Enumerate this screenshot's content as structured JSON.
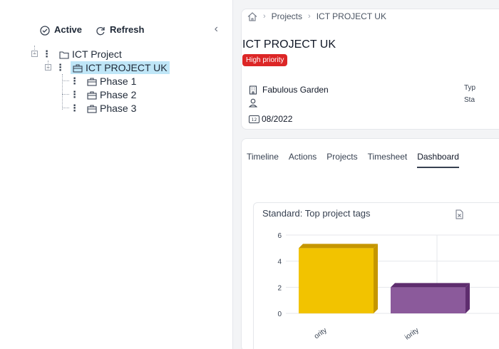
{
  "left_panel": {
    "active_label": "Active",
    "refresh_label": "Refresh",
    "tree": [
      {
        "label": "ICT Project",
        "icon": "folder-icon",
        "level": 0
      },
      {
        "label": "ICT PROJECT UK",
        "icon": "briefcase-icon",
        "level": 1,
        "selected": true
      },
      {
        "label": "Phase 1",
        "icon": "briefcase-icon",
        "level": 2
      },
      {
        "label": "Phase 2",
        "icon": "briefcase-icon",
        "level": 2
      },
      {
        "label": "Phase 3",
        "icon": "briefcase-icon",
        "level": 2
      }
    ]
  },
  "breadcrumb": {
    "items": [
      "Projects",
      "ICT PROJECT UK"
    ]
  },
  "project": {
    "title": "ICT PROJECT UK",
    "priority_badge": "High priority",
    "client": "Fabulous Garden",
    "owner": "",
    "date": "08/2022",
    "meta_type": "Typ",
    "meta_status": "Sta"
  },
  "tabs": [
    "Timeline",
    "Actions",
    "Projects",
    "Timesheet",
    "Dashboard"
  ],
  "active_tab": "Dashboard",
  "colors": {
    "accent_red": "#dc2626",
    "selected": "#bfe6f7",
    "bar1": "#f2c300",
    "bar2": "#8b5a9b"
  },
  "chart_data": {
    "type": "bar",
    "title": "Standard: Top project tags",
    "categories": [
      "ority",
      "iority"
    ],
    "values": [
      5,
      2
    ],
    "ylim": [
      0,
      6
    ],
    "yticks": [
      0,
      2,
      4,
      6
    ],
    "grid": true
  }
}
